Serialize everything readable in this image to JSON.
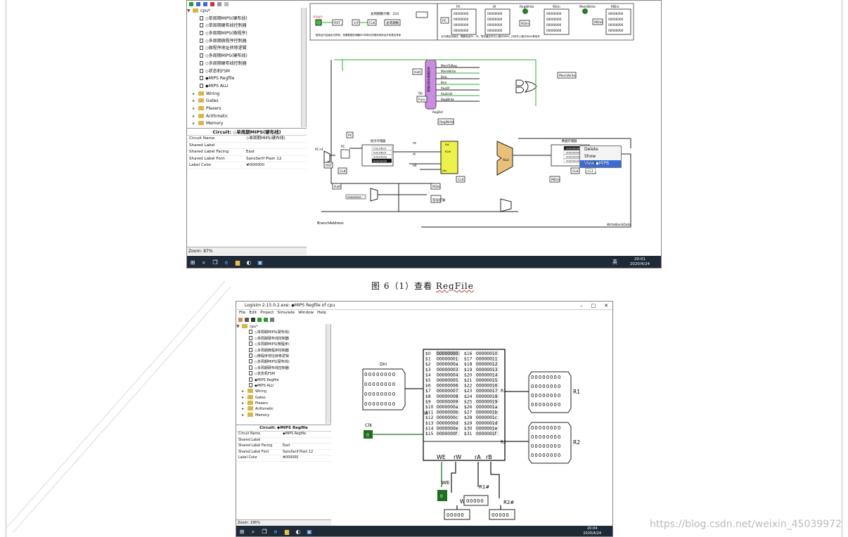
{
  "screenshot_top": {
    "tree_root": "cpu*",
    "tree_items": [
      "◇单周期MIPS(硬布线)",
      "◇单周期硬布线控制器",
      "◇多周期MIPS(微程序)",
      "◇多周期微程序控制器",
      "◇微程序地址转移逻辑",
      "◇多周期MIPS(硬布线)",
      "◇多周期硬布线控制器",
      "◇状态机FSM",
      "◆MIPS Regfile",
      "◆MIPS ALU"
    ],
    "tree_folders": [
      "Wiring",
      "Gates",
      "Plexers",
      "Arithmetic",
      "Memory"
    ],
    "attr_title": "Circuit: ◇单周期MIPS(硬布线)",
    "attr_rows": [
      [
        "Circuit Name",
        "◇单周期MIPS(硬布线)"
      ],
      [
        "Shared Label",
        ""
      ],
      [
        "Shared Label Facing",
        "East"
      ],
      [
        "Shared Label Font",
        "SansSerif Plain 12"
      ],
      [
        "Label Color",
        "#000000"
      ]
    ],
    "zoom": "Zoom: 87%",
    "clock_time": "20:01",
    "clock_date": "2020/4/24",
    "ime": "英",
    "context_menu": [
      "Delete",
      "Show Attributes",
      "View ◆MIPS Regfile"
    ],
    "labels": {
      "cycles": "总周期数计数：224",
      "note": "程序运行结束后可停机，查看数据存储器中0号单元的程序排序后升序是否排序",
      "note2": "为方便自动测试，需要验证PC、IR、寄存器文件写入端口RDin、内存写入端口MDin等信号",
      "pc": "PC",
      "ir": "IR",
      "regwrite": "RegWrite",
      "rdin": "RDin",
      "memwrite": "MemWrite",
      "mdin": "MDin",
      "rst": "RST",
      "clk": "CLK",
      "halt": "Halt",
      "memtoreg": "MemToReg",
      "memwrite2": "MemWrite",
      "beq": "Beq",
      "bne": "Bne",
      "aluop": "AluOP",
      "alusrcb": "AluSrcB",
      "regwrite2": "RegWrite",
      "regdst": "RegDst",
      "op": "Op",
      "func": "Func",
      "insmem": "指令存储器",
      "datamem": "数据存储器",
      "alu": "ALU",
      "pc4": "PC+4",
      "rs": "rs",
      "rt": "rt",
      "rd": "rd",
      "branch": "BranchAddress",
      "writeback": "WriteBackData",
      "insmem_rows": [
        "03e1f820",
        "03e1f820",
        "2002000a",
        "00000000"
      ],
      "datamem_rows": [
        "00000000",
        "00000000",
        "00000000",
        "00000000"
      ],
      "imm_val": "00000004",
      "controller_v": "单周期硬布线控制器"
    }
  },
  "caption": {
    "prefix": "图 6（1）查看 ",
    "underlined": "RegFile"
  },
  "screenshot_bottom": {
    "window_title": "Logisim 2.15.0.2.exe: ◆MIPS Regfile of cpu",
    "menu": [
      "File",
      "Edit",
      "Project",
      "Simulate",
      "Window",
      "Help"
    ],
    "tree_root": "cpu*",
    "tree_items": [
      "◇单周期MIPS(硬布线)",
      "◇单周期硬布线控制器",
      "◇多周期MIPS(微程序)",
      "◇多周期微程序控制器",
      "◇微程序地址转移逻辑",
      "◇多周期MIPS(硬布线)",
      "◇多周期硬布线控制器",
      "◇状态机FSM",
      "◆MIPS Regfile",
      "◆MIPS ALU"
    ],
    "tree_folders": [
      "Wiring",
      "Gates",
      "Plexers",
      "Arithmetic",
      "Memory"
    ],
    "attr_title": "Circuit: ◆MIPS Regfile",
    "attr_rows": [
      [
        "Circuit Name",
        "◆MIPS Regfile"
      ],
      [
        "Shared Label",
        ""
      ],
      [
        "Shared Label Facing",
        "East"
      ],
      [
        "Shared Label Font",
        "SansSerif Plain 12"
      ],
      [
        "Label Color",
        "#000000"
      ]
    ],
    "zoom": "Zoom: 195%",
    "clock_time": "20:04",
    "clock_date": "2020/4/24",
    "regs_left": [
      [
        "$0",
        "00000000"
      ],
      [
        "$1",
        "00000001"
      ],
      [
        "$2",
        "0000000a"
      ],
      [
        "$3",
        "00000003"
      ],
      [
        "$4",
        "00000004"
      ],
      [
        "$5",
        "00000005"
      ],
      [
        "$6",
        "00000006"
      ],
      [
        "$7",
        "00000007"
      ],
      [
        "$8",
        "00000008"
      ],
      [
        "$9",
        "00000009"
      ],
      [
        "$10",
        "0000000a"
      ],
      [
        "$11",
        "0000000b"
      ],
      [
        "$12",
        "0000000c"
      ],
      [
        "$13",
        "0000000d"
      ],
      [
        "$14",
        "0000000e"
      ],
      [
        "$15",
        "0000000f"
      ]
    ],
    "regs_right": [
      [
        "$16",
        "00000010"
      ],
      [
        "$17",
        "00000011"
      ],
      [
        "$18",
        "00000012"
      ],
      [
        "$19",
        "00000013"
      ],
      [
        "$20",
        "00000014"
      ],
      [
        "$21",
        "00000015"
      ],
      [
        "$22",
        "00000016"
      ],
      [
        "$23",
        "00000017"
      ],
      [
        "$24",
        "00000018"
      ],
      [
        "$25",
        "00000019"
      ],
      [
        "$26",
        "0000001a"
      ],
      [
        "$27",
        "0000001b"
      ],
      [
        "$28",
        "0000001c"
      ],
      [
        "$29",
        "0000001d"
      ],
      [
        "$30",
        "0000001e"
      ],
      [
        "$31",
        "0000001f"
      ]
    ],
    "ports": {
      "we": "WE",
      "rw": "rW",
      "ra": "rA",
      "rb": "rB",
      "w": "W",
      "r1": "R1",
      "r2": "R2"
    },
    "din": "Din",
    "clk": "Clk",
    "clk_val": "0",
    "we_label": "WE",
    "we_val": "0",
    "w_label": "W",
    "r1_label": "R1#",
    "r2_label": "R2#",
    "zeros8": "00000000",
    "zeros5": "00000",
    "zeros4": "0000"
  },
  "watermark": "https://blog.csdn.net/weixin_45039972",
  "colors": {
    "accent_green": "#1e6f1e",
    "wire_green": "#2fa82f",
    "taskbar": "#1f2a38",
    "highlight_yellow": "#ecf24a",
    "controller_purple": "#c98ee0"
  }
}
